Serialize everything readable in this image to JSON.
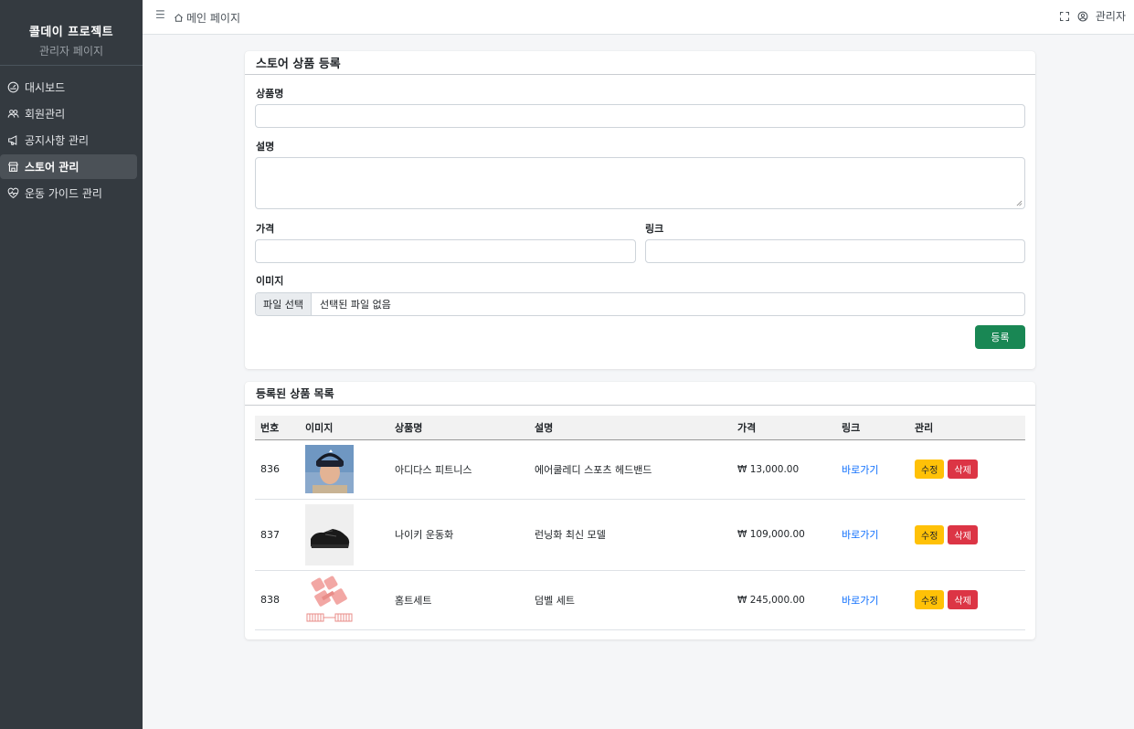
{
  "sidebar": {
    "brand_title": "콜데이 프로젝트",
    "brand_sub": "관리자 페이지",
    "items": [
      {
        "label": "대시보드",
        "icon": "dashboard-icon"
      },
      {
        "label": "회원관리",
        "icon": "users-icon"
      },
      {
        "label": "공지사항 관리",
        "icon": "megaphone-icon"
      },
      {
        "label": "스토어 관리",
        "icon": "shop-icon",
        "active": true
      },
      {
        "label": "운동 가이드 관리",
        "icon": "heart-icon"
      }
    ]
  },
  "topbar": {
    "menu_icon": "☰",
    "breadcrumb": "메인 페이지",
    "user_label": "관리자"
  },
  "form": {
    "title": "스토어 상품 등록",
    "name_label": "상품명",
    "desc_label": "설명",
    "price_label": "가격",
    "link_label": "링크",
    "image_label": "이미지",
    "file_button": "파일 선택",
    "file_status": "선택된 파일 없음",
    "submit_label": "등록"
  },
  "products": {
    "title": "등록된 상품 목록",
    "columns": [
      "번호",
      "이미지",
      "상품명",
      "설명",
      "가격",
      "링크",
      "관리"
    ],
    "rows": [
      {
        "id": "836",
        "name": "아디다스 피트니스",
        "desc": "에어쿨레디 스포츠 헤드밴드",
        "price": "₩ 13,000.00",
        "link": "바로가기",
        "edit": "수정",
        "delete": "삭제"
      },
      {
        "id": "837",
        "name": "나이키 운동화",
        "desc": "런닝화 최신 모델",
        "price": "₩ 109,000.00",
        "link": "바로가기",
        "edit": "수정",
        "delete": "삭제"
      },
      {
        "id": "838",
        "name": "홈트세트",
        "desc": "덤벨 세트",
        "price": "₩ 245,000.00",
        "link": "바로가기",
        "edit": "수정",
        "delete": "삭제"
      }
    ]
  },
  "colors": {
    "sidebar_bg": "#343a40",
    "primary_green": "#198754",
    "edit_yellow": "#ffc107",
    "delete_red": "#dc3545",
    "link_blue": "#0d6efd"
  }
}
